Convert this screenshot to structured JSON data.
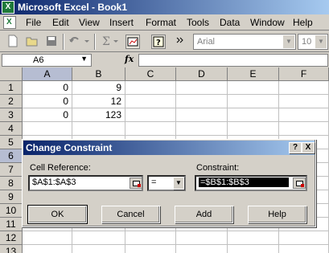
{
  "window": {
    "title": "Microsoft Excel - Book1",
    "app_icon": "excel-icon"
  },
  "menu": {
    "items": [
      {
        "label": "File",
        "u": "F"
      },
      {
        "label": "Edit",
        "u": "E"
      },
      {
        "label": "View",
        "u": "V"
      },
      {
        "label": "Insert",
        "u": "I"
      },
      {
        "label": "Format",
        "u": "o"
      },
      {
        "label": "Tools",
        "u": "T"
      },
      {
        "label": "Data",
        "u": "D"
      },
      {
        "label": "Window",
        "u": "W"
      },
      {
        "label": "Help",
        "u": "H"
      }
    ]
  },
  "toolbar": {
    "font": "Arial",
    "size": "10"
  },
  "formula_bar": {
    "name_box": "A6",
    "fx": "fx",
    "formula": ""
  },
  "grid": {
    "columns": [
      "A",
      "B",
      "C",
      "D",
      "E",
      "F"
    ],
    "rows": [
      "1",
      "2",
      "3",
      "4",
      "5",
      "6",
      "7",
      "8",
      "9",
      "10",
      "11",
      "12",
      "13"
    ],
    "cells": [
      [
        "0",
        "9",
        "",
        "",
        "",
        ""
      ],
      [
        "0",
        "12",
        "",
        "",
        "",
        ""
      ],
      [
        "0",
        "123",
        "",
        "",
        "",
        ""
      ]
    ],
    "active_column": "A",
    "active_row": "6"
  },
  "dialog": {
    "title": "Change Constraint",
    "help_glyph": "?",
    "close_glyph": "X",
    "cell_reference_label": "Cell Reference:",
    "cell_reference_value": "$A$1:$A$3",
    "operator_value": "=",
    "constraint_label": "Constraint:",
    "constraint_value": "=$B$1:$B$3",
    "buttons": {
      "ok": "OK",
      "cancel": "Cancel",
      "add": "Add",
      "help": "Help"
    }
  }
}
